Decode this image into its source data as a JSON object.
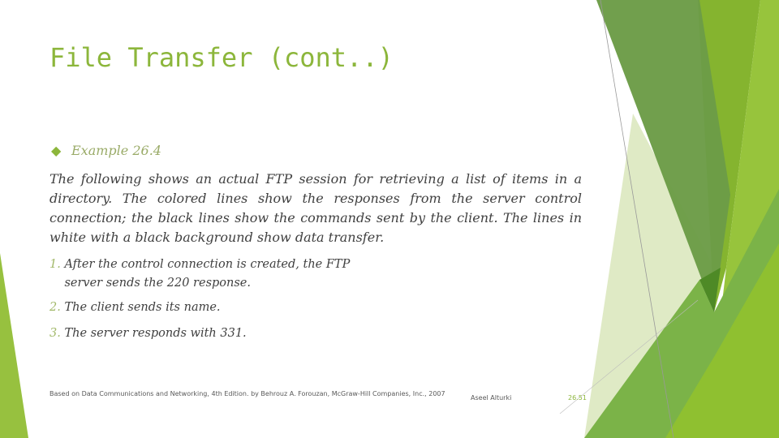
{
  "slide": {
    "title": "File Transfer (cont..)",
    "bullet_icon": "diamond-icon",
    "example_label": "Example 26.4",
    "paragraph": "The following shows an actual FTP session for retrieving a list of items in a directory. The colored lines show the responses from the server control connection; the black lines show the commands sent by the client. The lines in white with a black background show data transfer.",
    "steps": [
      {
        "num": "1.",
        "text": "After the control connection is created, the FTP server sends the 220 response."
      },
      {
        "num": "2.",
        "text": "The client sends its name."
      },
      {
        "num": "3.",
        "text": "The server responds with 331."
      }
    ]
  },
  "footer": {
    "source": "Based on Data Communications and Networking, 4th Edition. by Behrouz A. Forouzan, McGraw-Hill Companies, Inc., 2007",
    "author": "Aseel Alturki",
    "page": "26.51"
  },
  "colors": {
    "accent": "#8cb63b",
    "dark_green": "#6c9c47",
    "light_green": "#97c43c"
  }
}
